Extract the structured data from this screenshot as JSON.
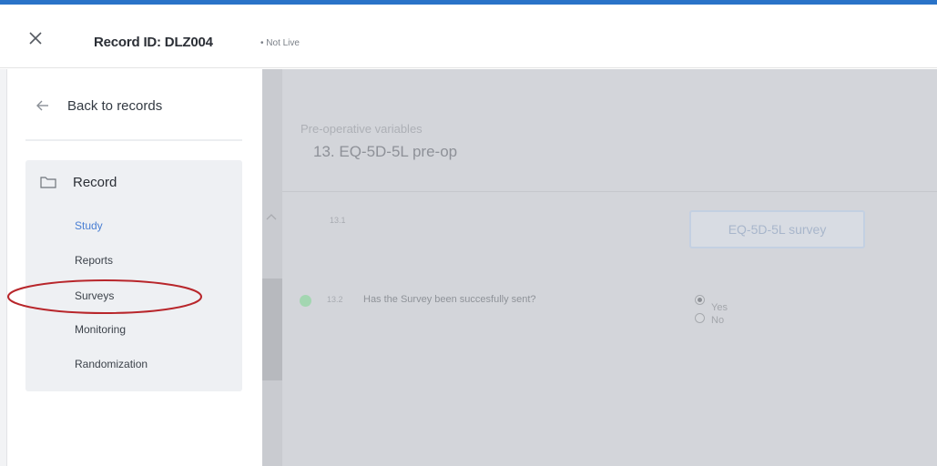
{
  "header": {
    "record_id_label": "Record ID: DLZ004",
    "live_status": "• Not Live",
    "accent_color": "#2a73c8"
  },
  "sidebar": {
    "back_label": "Back to records",
    "record_label": "Record",
    "items": [
      {
        "label": "Study",
        "active": true
      },
      {
        "label": "Reports",
        "active": false
      },
      {
        "label": "Surveys",
        "active": false,
        "highlighted": true
      },
      {
        "label": "Monitoring",
        "active": false
      },
      {
        "label": "Randomization",
        "active": false
      }
    ],
    "active_color": "#4a7fd3",
    "highlight_color": "#b8262b"
  },
  "content": {
    "section_kicker": "Pre-operative variables",
    "section_title": "13. EQ-5D-5L pre-op",
    "questions": [
      {
        "number": "13.1",
        "button_label": "EQ-5D-5L survey"
      },
      {
        "number": "13.2",
        "text": "Has the Survey been succesfully sent?",
        "options": [
          {
            "label": "Yes",
            "selected": true
          },
          {
            "label": "No",
            "selected": false
          }
        ],
        "status_color": "#a3d6b1"
      }
    ]
  },
  "icons": [
    "close-icon",
    "arrow-left-icon",
    "folder-icon",
    "chevron-up-icon"
  ]
}
